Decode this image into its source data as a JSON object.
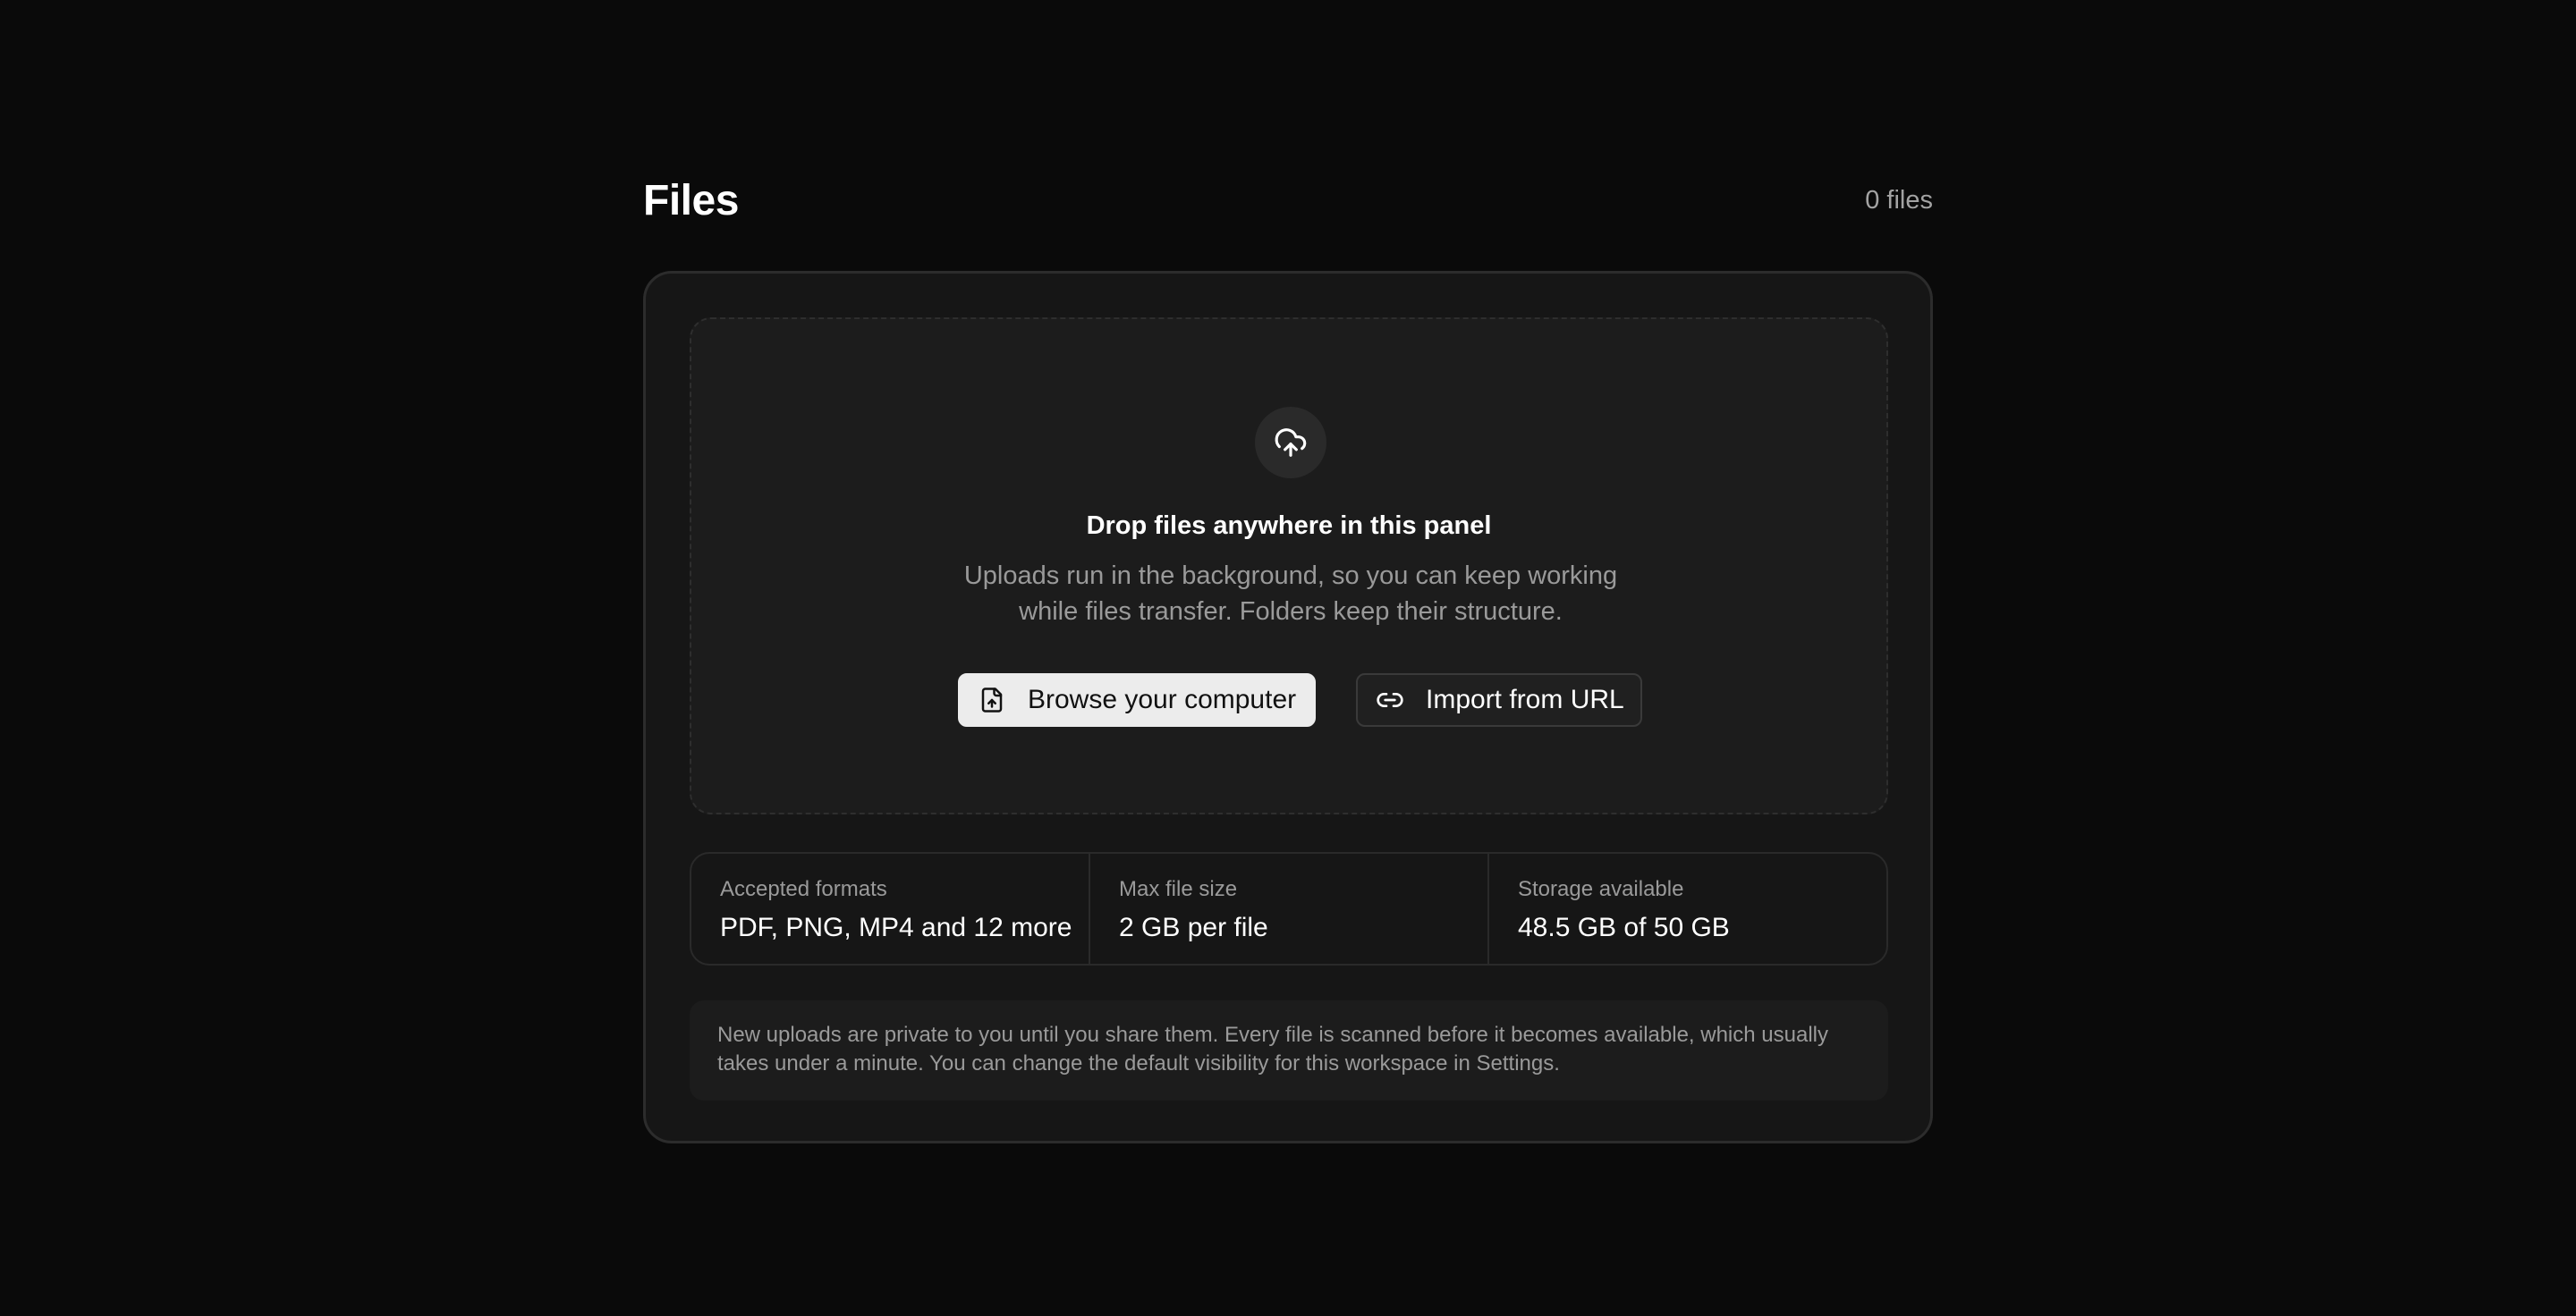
{
  "header": {
    "title": "Files",
    "count": "0 files"
  },
  "dropzone": {
    "icon": "cloud-upload-icon",
    "title": "Drop files anywhere in this panel",
    "description": "Uploads run in the background, so you can keep working while files transfer. Folders keep their structure.",
    "browse_label": "Browse your computer",
    "browse_icon": "file-upload-icon",
    "import_label": "Import from URL",
    "import_icon": "link-icon"
  },
  "info": [
    {
      "label": "Accepted formats",
      "value": "PDF, PNG, MP4 and 12 more"
    },
    {
      "label": "Max file size",
      "value": "2 GB per file"
    },
    {
      "label": "Storage available",
      "value": "48.5 GB of 50 GB"
    }
  ],
  "notice": "New uploads are private to you until you share them. Every file is scanned before it becomes available, which usually takes under a minute. You can change the default visibility for this workspace in Settings.",
  "colors": {
    "background": "#0a0a0a",
    "card": "#161616",
    "dropzone": "#1c1c1c",
    "primary_button": "#ececec",
    "muted_text": "#9a9a9a"
  }
}
